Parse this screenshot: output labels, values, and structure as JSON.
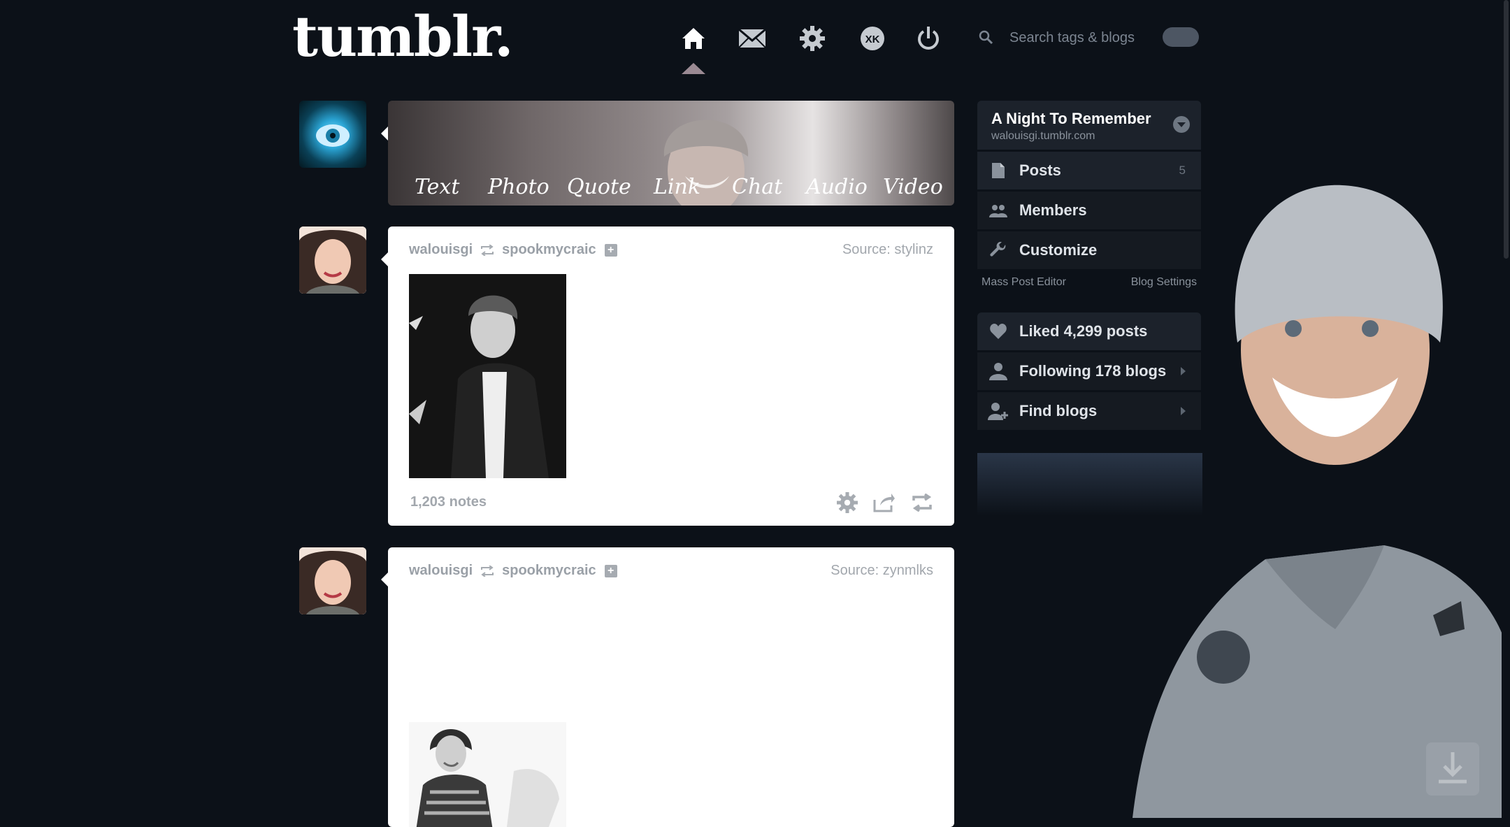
{
  "header": {
    "logo": "tumblr.",
    "search_placeholder": "Search tags & blogs"
  },
  "nav": {
    "items": [
      "home-icon",
      "mail-icon",
      "gear-icon",
      "xkit-icon",
      "power-icon"
    ],
    "active": "home-icon"
  },
  "post_types": [
    "Text",
    "Photo",
    "Quote",
    "Link",
    "Chat",
    "Audio",
    "Video"
  ],
  "posts": [
    {
      "author": "walouisgi",
      "reblogged_from": "spookmycraic",
      "source": "Source: stylinz",
      "notes": "1,203 notes"
    },
    {
      "author": "walouisgi",
      "reblogged_from": "spookmycraic",
      "source": "Source: zynmlks"
    }
  ],
  "sidebar": {
    "blog_title": "A Night To Remember",
    "blog_url": "walouisgi.tumblr.com",
    "items": [
      {
        "label": "Posts",
        "count": "5"
      },
      {
        "label": "Members"
      },
      {
        "label": "Customize"
      }
    ],
    "links": [
      "Mass Post Editor",
      "Blog Settings"
    ],
    "activity": [
      {
        "label": "Liked 4,299 posts"
      },
      {
        "label": "Following 178 blogs"
      },
      {
        "label": "Find blogs"
      }
    ]
  },
  "colors": {
    "background": "#0c1118",
    "sidebar": "#151a21",
    "post": "#ffffff"
  }
}
